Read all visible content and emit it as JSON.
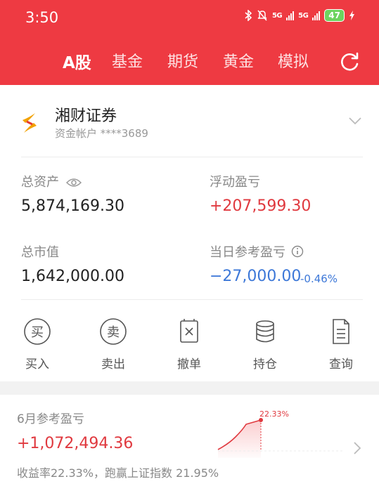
{
  "status": {
    "time": "3:50",
    "net1": "5G",
    "net2": "5G",
    "battery": "47"
  },
  "tabs": [
    {
      "label": "A股",
      "active": true
    },
    {
      "label": "基金",
      "active": false
    },
    {
      "label": "期货",
      "active": false
    },
    {
      "label": "黄金",
      "active": false
    },
    {
      "label": "模拟",
      "active": false
    }
  ],
  "account": {
    "broker": "湘财证券",
    "account_label": "资金帐户 ****3689",
    "total_assets_label": "总资产",
    "total_assets": "5,874,169.30",
    "floating_pl_label": "浮动盈亏",
    "floating_pl": "+207,599.30",
    "market_value_label": "总市值",
    "market_value": "1,642,000.00",
    "daily_pl_label": "当日参考盈亏",
    "daily_pl": "−27,000.00",
    "daily_pl_pct": "-0.46%"
  },
  "actions": [
    {
      "label": "买入",
      "glyph": "买"
    },
    {
      "label": "卖出",
      "glyph": "卖"
    },
    {
      "label": "撤单"
    },
    {
      "label": "持仓"
    },
    {
      "label": "查询"
    }
  ],
  "monthly": {
    "title": "6月参考盈亏",
    "value": "+1,072,494.36",
    "desc": "收益率22.33%，跑赢上证指数 21.95%",
    "chart_label": "22.33%"
  },
  "colors": {
    "header": "#ee3a42",
    "gain": "#e0393f",
    "loss": "#3d78d8"
  }
}
